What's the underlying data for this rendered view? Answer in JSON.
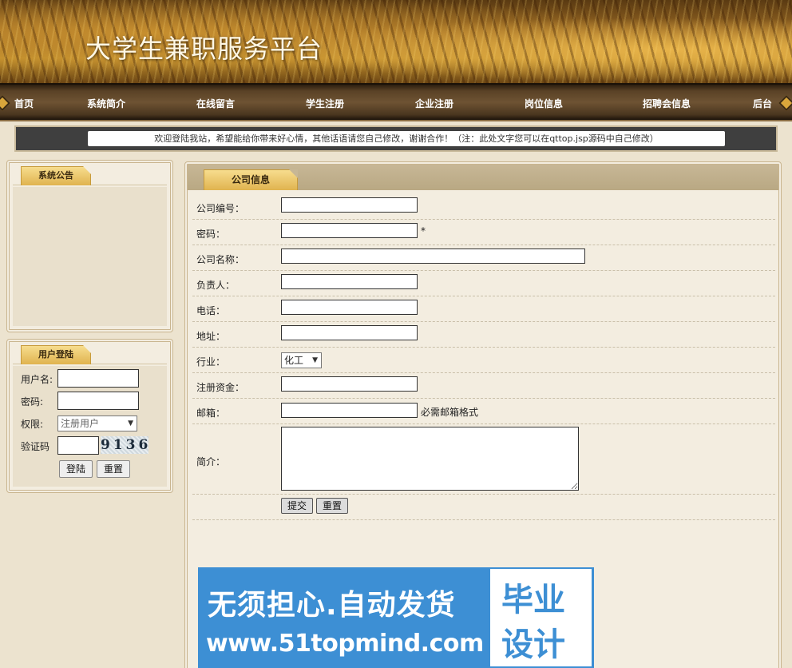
{
  "site": {
    "title": "大学生兼职服务平台"
  },
  "nav": {
    "items": [
      {
        "label": "首页"
      },
      {
        "label": "系统简介"
      },
      {
        "label": "在线留言"
      },
      {
        "label": "学生注册"
      },
      {
        "label": "企业注册"
      },
      {
        "label": "岗位信息"
      },
      {
        "label": "招聘会信息"
      },
      {
        "label": "后台"
      }
    ]
  },
  "marquee": {
    "text": "欢迎登陆我站，希望能给你带来好心情，其他话语请您自己修改，谢谢合作！（注：此处文字您可以在qttop.jsp源码中自己修改）"
  },
  "announcement": {
    "title": "系统公告"
  },
  "login": {
    "title": "用户登陆",
    "username_label": "用户名:",
    "password_label": "密码:",
    "role_label": "权限:",
    "role_selected": "注册用户",
    "captcha_label": "验证码",
    "captcha_code": "9136",
    "login_button": "登陆",
    "reset_button": "重置"
  },
  "company_form": {
    "title": "公司信息",
    "fields": {
      "company_id": "公司编号：",
      "password": "密码：",
      "password_required": "*",
      "company_name": "公司名称：",
      "manager": "负责人：",
      "phone": "电话：",
      "address": "地址：",
      "industry": "行业：",
      "industry_selected": "化工",
      "capital": "注册资金：",
      "email": "邮箱：",
      "email_hint": "必需邮箱格式",
      "intro": "简介："
    },
    "submit_button": "提交",
    "reset_button": "重置"
  },
  "promo": {
    "line1": "无须担心.自动发货",
    "line2": "www.51topmind.com",
    "badge_line1": "毕业",
    "badge_line2": "设计"
  }
}
